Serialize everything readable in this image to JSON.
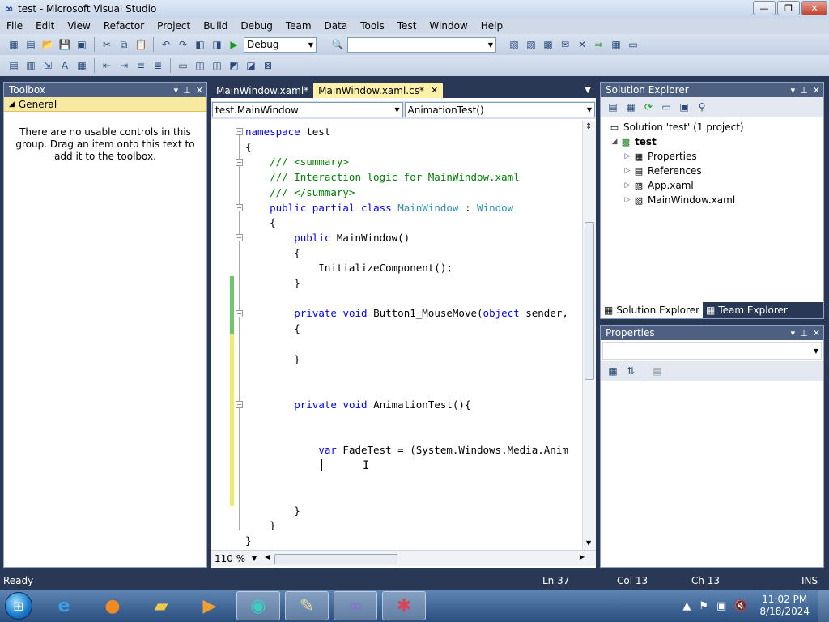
{
  "window": {
    "title": "test - Microsoft Visual Studio",
    "controls": {
      "minimize": "—",
      "maximize": "❐",
      "close": "✕"
    }
  },
  "menu": [
    "File",
    "Edit",
    "View",
    "Refactor",
    "Project",
    "Build",
    "Debug",
    "Team",
    "Data",
    "Tools",
    "Test",
    "Window",
    "Help"
  ],
  "toolbar": {
    "config_value": "Debug",
    "platform_value": ""
  },
  "toolbox": {
    "header": "Toolbox",
    "group": "General",
    "empty_message": "There are no usable controls in this group. Drag an item onto this text to add it to the toolbox."
  },
  "editor": {
    "tabs": [
      {
        "label": "MainWindow.xaml*",
        "active": false
      },
      {
        "label": "MainWindow.xaml.cs*",
        "active": true
      }
    ],
    "nav_type": "test.MainWindow",
    "nav_member": "AnimationTest()",
    "zoom": "110 %"
  },
  "code_lines": [
    "namespace test",
    "{",
    "    /// <summary>",
    "    /// Interaction logic for MainWindow.xaml",
    "    /// </summary>",
    "    public partial class MainWindow : Window",
    "    {",
    "        public MainWindow()",
    "        {",
    "            InitializeComponent();",
    "        }",
    "",
    "        private void Button1_MouseMove(object sender,",
    "        {",
    "",
    "        }",
    "",
    "",
    "        private void AnimationTest(){",
    "",
    "",
    "            var FadeTest = (System.Windows.Media.Anim",
    "",
    "",
    "",
    "        }",
    "    }",
    "}"
  ],
  "solution_explorer": {
    "header": "Solution Explorer",
    "solution": "Solution 'test' (1 project)",
    "project": "test",
    "items": [
      "Properties",
      "References",
      "App.xaml",
      "MainWindow.xaml"
    ],
    "tabs": [
      "Solution Explorer",
      "Team Explorer"
    ]
  },
  "properties": {
    "header": "Properties"
  },
  "status": {
    "state": "Ready",
    "ln": "Ln 37",
    "col": "Col 13",
    "ch": "Ch 13",
    "mode": "INS"
  },
  "taskbar": {
    "time": "11:02 PM",
    "date": "8/18/2024"
  }
}
